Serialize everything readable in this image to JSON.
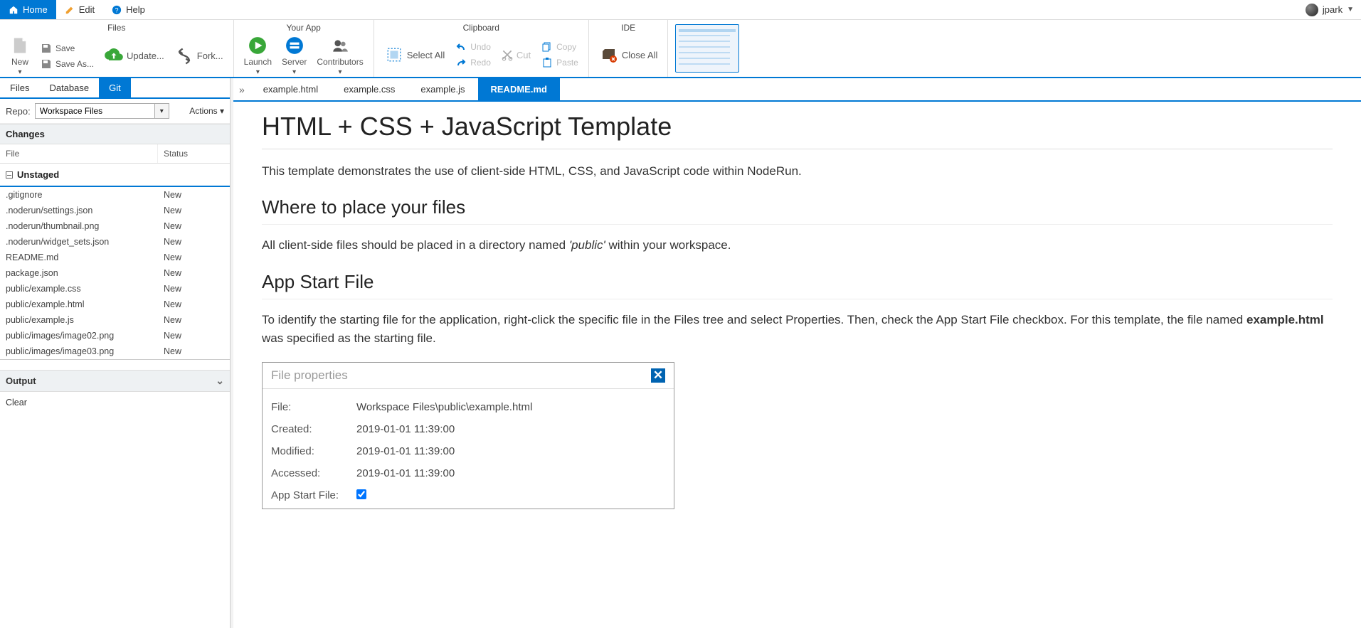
{
  "topbar": {
    "home": "Home",
    "edit": "Edit",
    "help": "Help",
    "user": "jpark"
  },
  "ribbon": {
    "groups": {
      "files": {
        "title": "Files",
        "new": "New",
        "save": "Save",
        "saveas": "Save As...",
        "update": "Update...",
        "fork": "Fork..."
      },
      "app": {
        "title": "Your App",
        "launch": "Launch",
        "server": "Server",
        "contributors": "Contributors"
      },
      "clipboard": {
        "title": "Clipboard",
        "selectall": "Select All",
        "undo": "Undo",
        "redo": "Redo",
        "cut": "Cut",
        "copy": "Copy",
        "paste": "Paste"
      },
      "ide": {
        "title": "IDE",
        "closeall": "Close All"
      }
    }
  },
  "sidebar": {
    "tabs": {
      "files": "Files",
      "database": "Database",
      "git": "Git"
    },
    "repo_label": "Repo:",
    "repo_value": "Workspace Files",
    "actions": "Actions ▾",
    "changes": "Changes",
    "col_file": "File",
    "col_status": "Status",
    "unstaged": "Unstaged",
    "files": [
      {
        "file": ".gitignore",
        "status": "New"
      },
      {
        "file": ".noderun/settings.json",
        "status": "New"
      },
      {
        "file": ".noderun/thumbnail.png",
        "status": "New"
      },
      {
        "file": ".noderun/widget_sets.json",
        "status": "New"
      },
      {
        "file": "README.md",
        "status": "New"
      },
      {
        "file": "package.json",
        "status": "New"
      },
      {
        "file": "public/example.css",
        "status": "New"
      },
      {
        "file": "public/example.html",
        "status": "New"
      },
      {
        "file": "public/example.js",
        "status": "New"
      },
      {
        "file": "public/images/image02.png",
        "status": "New"
      },
      {
        "file": "public/images/image03.png",
        "status": "New"
      }
    ],
    "output": "Output",
    "clear": "Clear"
  },
  "editor": {
    "tabs": [
      "example.html",
      "example.css",
      "example.js",
      "README.md"
    ],
    "active": "README.md"
  },
  "doc": {
    "h1": "HTML + CSS + JavaScript Template",
    "p1": "This template demonstrates the use of client-side HTML, CSS, and JavaScript code within NodeRun.",
    "h2a": "Where to place your files",
    "p2a": "All client-side files should be placed in a directory named ",
    "p2_em": "'public'",
    "p2b": " within your workspace.",
    "h2b": "App Start File",
    "p3a": "To identify the starting file for the application, right-click the specific file in the Files tree and select Properties. Then, check the App Start File checkbox. For this template, the file named ",
    "p3_strong": "example.html",
    "p3b": " was specified as the starting file."
  },
  "dialog": {
    "title": "File properties",
    "rows": {
      "file_l": "File:",
      "file_v": "Workspace Files\\public\\example.html",
      "created_l": "Created:",
      "created_v": "2019-01-01 11:39:00",
      "modified_l": "Modified:",
      "modified_v": "2019-01-01 11:39:00",
      "accessed_l": "Accessed:",
      "accessed_v": "2019-01-01 11:39:00",
      "appstart_l": "App Start File:"
    }
  }
}
